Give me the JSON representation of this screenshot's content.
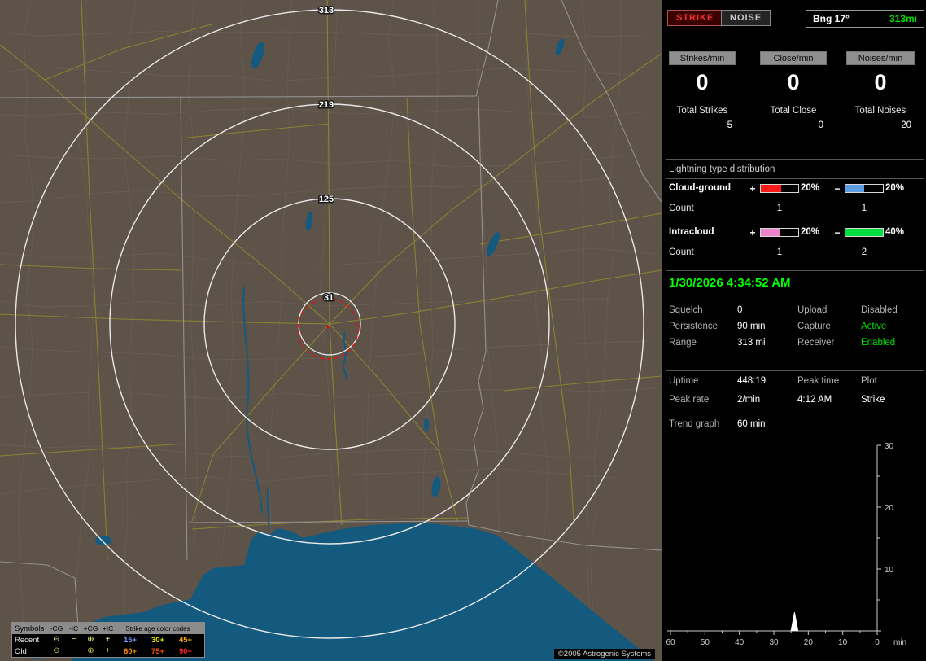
{
  "map": {
    "ring_labels": [
      "313",
      "219",
      "125",
      "31"
    ],
    "copyright": "©2005 Astrogenic Systems",
    "legend": {
      "symbols_header": "Symbols",
      "age_header": "Strike age color codes",
      "columns": [
        "-CG",
        "-IC",
        "+CG",
        "+IC"
      ],
      "symbols": [
        "⊖",
        "−",
        "⊕",
        "+"
      ],
      "rows": [
        {
          "label": "Recent",
          "symbol_color": "#eeee90",
          "ages": [
            {
              "text": "15+",
              "color": "#7a96ff"
            },
            {
              "text": "30+",
              "color": "#e8e800"
            },
            {
              "text": "45+",
              "color": "#ffb400"
            }
          ]
        },
        {
          "label": "Old",
          "symbol_color": "#cfcf58",
          "ages": [
            {
              "text": "60+",
              "color": "#ff9000"
            },
            {
              "text": "75+",
              "color": "#ff5400"
            },
            {
              "text": "90+",
              "color": "#ff2222"
            }
          ]
        }
      ]
    }
  },
  "panel": {
    "buttons": {
      "strike": "STRIKE",
      "noise": "NOISE"
    },
    "bearing": {
      "label": "Bng 17°",
      "range": "313mi"
    },
    "rates": [
      {
        "label": "Strikes/min",
        "value": "0"
      },
      {
        "label": "Close/min",
        "value": "0"
      },
      {
        "label": "Noises/min",
        "value": "0"
      }
    ],
    "totals": [
      {
        "label": "Total Strikes",
        "value": "5"
      },
      {
        "label": "Total Close",
        "value": "0"
      },
      {
        "label": "Total Noises",
        "value": "20"
      }
    ],
    "distribution": {
      "title": "Lightning type distribution",
      "count_label": "Count",
      "plus_sign": "+",
      "minus_sign": "−",
      "rows": [
        {
          "label": "Cloud-ground",
          "plus": {
            "pct": "20%",
            "fill": 55,
            "color": "#ff1a1a",
            "count": "1"
          },
          "minus": {
            "pct": "20%",
            "fill": 50,
            "color": "#5d9be0",
            "count": "1"
          }
        },
        {
          "label": "Intracloud",
          "plus": {
            "pct": "20%",
            "fill": 50,
            "color": "#ee82c8",
            "count": "1"
          },
          "minus": {
            "pct": "40%",
            "fill": 100,
            "color": "#00e040",
            "count": "2"
          }
        }
      ]
    },
    "clock": "1/30/2026 4:34:52 AM",
    "settings": [
      {
        "label": "Squelch",
        "value": "0"
      },
      {
        "label": "Persistence",
        "value": "90 min"
      },
      {
        "label": "Range",
        "value": "313 mi"
      }
    ],
    "status": [
      {
        "label": "Upload",
        "value": "Disabled",
        "color": "#b0b0b0"
      },
      {
        "label": "Capture",
        "value": "Active",
        "color": "#00e000"
      },
      {
        "label": "Receiver",
        "value": "Enabled",
        "color": "#00e000"
      }
    ],
    "stats": {
      "uptime_label": "Uptime",
      "uptime": "448:19",
      "peak_time_label": "Peak time",
      "peak_time": "4:12 AM",
      "plot_label": "Plot",
      "plot": "Strike",
      "peak_rate_label": "Peak rate",
      "peak_rate": "2/min",
      "trend_label": "Trend graph",
      "trend_value": "60 min"
    }
  },
  "chart_data": {
    "type": "line",
    "title": "Trend graph",
    "x_unit": "min",
    "x_ticks": [
      60,
      50,
      40,
      30,
      20,
      10,
      0
    ],
    "y_ticks": [
      10,
      20,
      30
    ],
    "xlim": [
      60,
      0
    ],
    "ylim": [
      0,
      30
    ],
    "legend_position": "none",
    "series": [
      {
        "name": "Strike",
        "points": [
          {
            "x": 25,
            "y": 0
          },
          {
            "x": 24,
            "y": 3
          },
          {
            "x": 23,
            "y": 0
          }
        ]
      }
    ]
  }
}
